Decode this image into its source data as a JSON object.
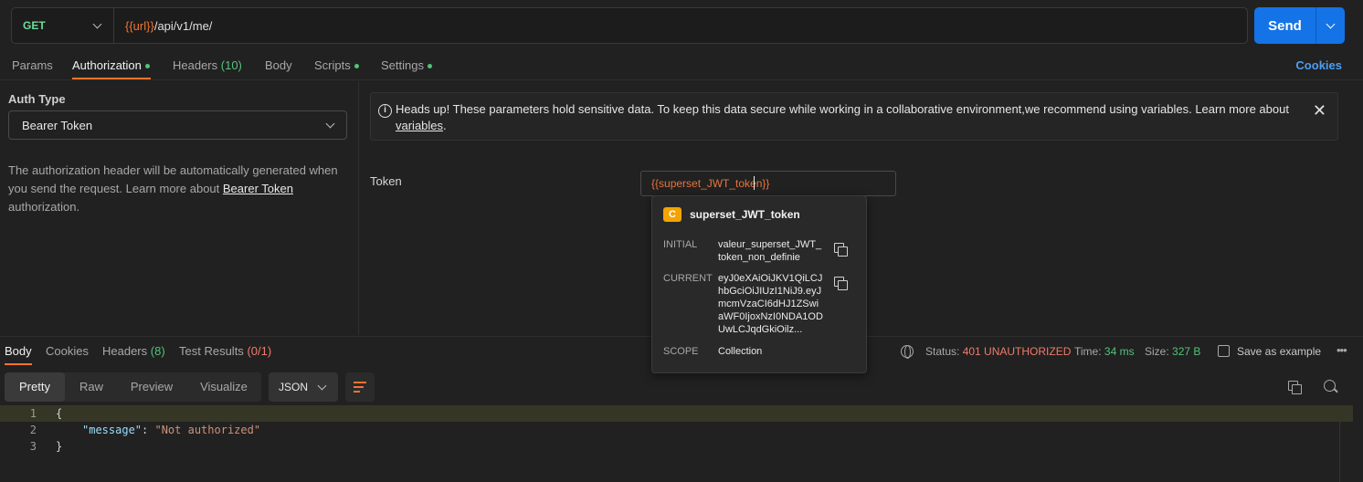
{
  "request": {
    "method": "GET",
    "url_var": "{{url}}",
    "url_path": "/api/v1/me/",
    "send_label": "Send"
  },
  "request_tabs": {
    "params": "Params",
    "authorization": "Authorization",
    "headers": "Headers",
    "headers_count": "(10)",
    "body": "Body",
    "scripts": "Scripts",
    "settings": "Settings",
    "cookies": "Cookies"
  },
  "auth": {
    "type_label": "Auth Type",
    "type_value": "Bearer Token",
    "desc_before": "The authorization header will be automatically generated when you send the request. Learn more about ",
    "desc_link": "Bearer Token",
    "desc_after": " authorization."
  },
  "warning": {
    "text": "Heads up! These parameters hold sensitive data. To keep this data secure while working in a collaborative environment,we recommend using variables. Learn more about ",
    "link": "variables",
    "end": "."
  },
  "token": {
    "label": "Token",
    "value": "{{superset_JWT_token}}"
  },
  "variable_popup": {
    "badge": "C",
    "name": "superset_JWT_token",
    "initial_label": "INITIAL",
    "initial_value": "valeur_superset_JWT_token_non_definie",
    "current_label": "CURRENT",
    "current_value": "eyJ0eXAiOiJKV1QiLCJhbGciOiJIUzI1NiJ9.eyJmcmVzaCI6dHJ1ZSwiaWF0IjoxNzI0NDA1ODUwLCJqdGkiOilz...",
    "scope_label": "SCOPE",
    "scope_value": "Collection"
  },
  "response": {
    "tabs": {
      "body": "Body",
      "cookies": "Cookies",
      "headers": "Headers",
      "headers_count": "(8)",
      "tests": "Test Results",
      "tests_count": "(0/1)"
    },
    "status_label": "Status:",
    "status_value": "401 UNAUTHORIZED",
    "time_label": "Time:",
    "time_value": "34 ms",
    "size_label": "Size:",
    "size_value": "327 B",
    "save_example": "Save as example",
    "view_tabs": [
      "Pretty",
      "Raw",
      "Preview",
      "Visualize"
    ],
    "format": "JSON",
    "code_lines": [
      {
        "n": "1",
        "text": "{"
      },
      {
        "n": "2",
        "key": "\"message\"",
        "sep": ": ",
        "str": "\"Not authorized\""
      },
      {
        "n": "3",
        "text": "}"
      }
    ]
  },
  "colors": {
    "accent": "#f0742e",
    "send": "#1473e6",
    "method_get": "#6bdd9a",
    "status_error": "#f07b6a",
    "ok": "#53c27b"
  }
}
